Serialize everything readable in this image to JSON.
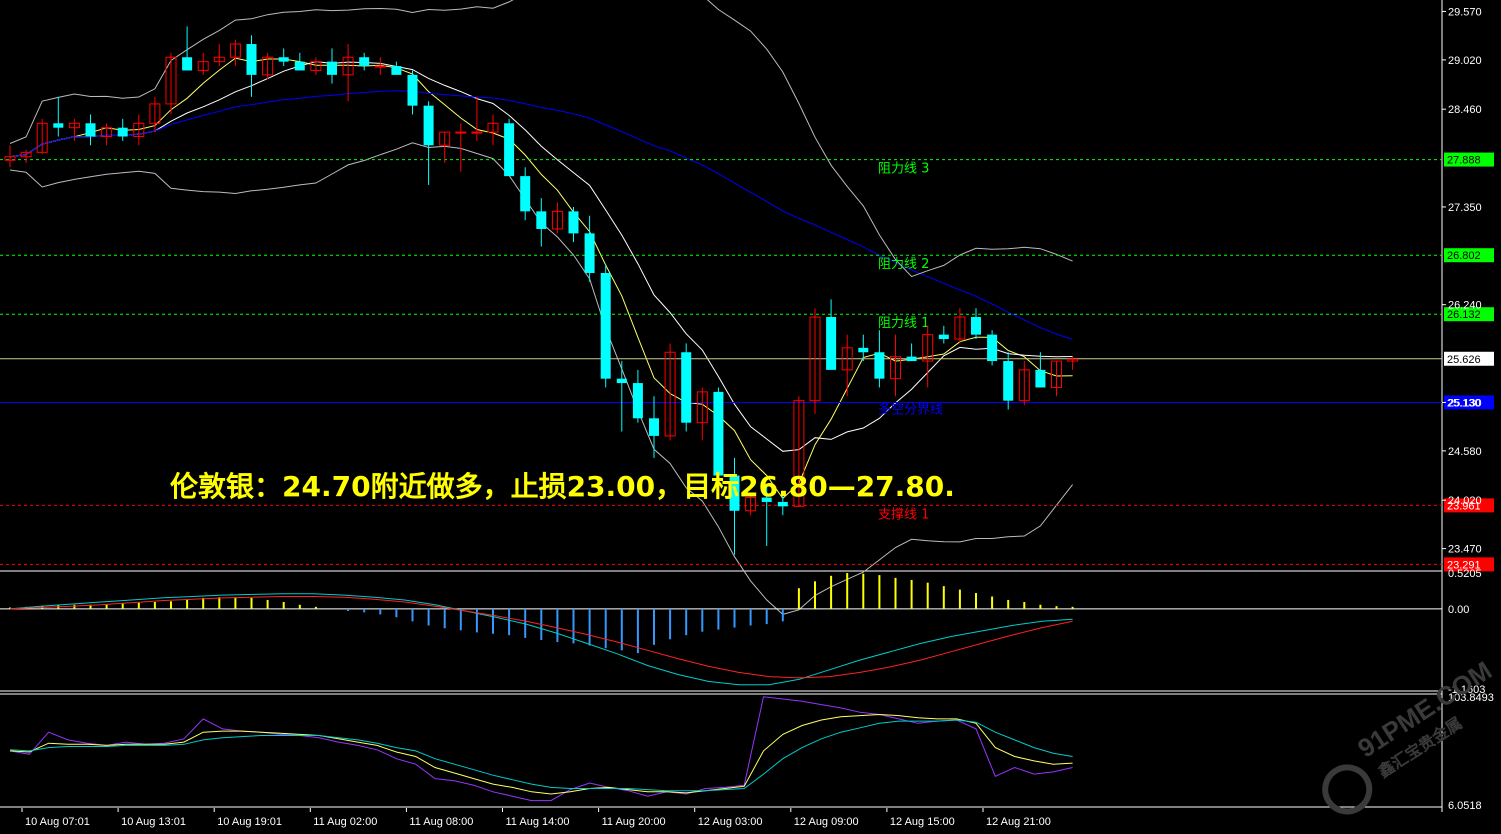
{
  "headline": "伦敦银：24.70附近做多，止损23.00，目标26.80—27.80.",
  "watermark": {
    "brand": "91PME.COM",
    "cn": "鑫汇宝贵金属"
  },
  "colors": {
    "bull": "#ff0000",
    "bear": "#00ffff",
    "ma_blue": "#0000ff",
    "resist": "#00ff00",
    "support": "#ff0000",
    "current": "#ffffff"
  },
  "chart_data": [
    {
      "type": "candlestick",
      "panel": "main",
      "ylim": [
        23.25,
        29.7
      ],
      "y_ticks": [
        "29.570",
        "29.020",
        "28.460",
        "27.350",
        "26.240",
        "25.130",
        "24.580",
        "24.020",
        "23.470"
      ],
      "x_ticks": [
        "10 Aug 07:01",
        "10 Aug 13:01",
        "10 Aug 19:01",
        "11 Aug 02:00",
        "11 Aug 08:00",
        "11 Aug 14:00",
        "11 Aug 20:00",
        "12 Aug 03:00",
        "12 Aug 09:00",
        "12 Aug 15:00",
        "12 Aug 21:00"
      ],
      "levels": [
        {
          "name": "阻力线 3",
          "value": 27.888,
          "label": "27.888",
          "kind": "resist"
        },
        {
          "name": "阻力线 2",
          "value": 26.802,
          "label": "26.802",
          "kind": "resist"
        },
        {
          "name": "阻力线 1",
          "value": 26.132,
          "label": "26.132",
          "kind": "resist"
        },
        {
          "name": "",
          "value": 25.626,
          "label": "25.626",
          "kind": "current"
        },
        {
          "name": "多空分界线",
          "value": 25.13,
          "label": "25.130",
          "kind": "pivot"
        },
        {
          "name": "支撑线 1",
          "value": 23.961,
          "label": "23.961",
          "kind": "support"
        },
        {
          "name": "",
          "value": 23.291,
          "label": "23.291",
          "kind": "support"
        }
      ],
      "ohlc": [
        [
          27.88,
          28.05,
          27.8,
          27.92
        ],
        [
          27.92,
          28.0,
          27.85,
          27.97
        ],
        [
          27.97,
          28.35,
          27.95,
          28.3
        ],
        [
          28.3,
          28.6,
          28.15,
          28.25
        ],
        [
          28.25,
          28.35,
          28.1,
          28.3
        ],
        [
          28.3,
          28.4,
          28.05,
          28.15
        ],
        [
          28.15,
          28.3,
          28.05,
          28.25
        ],
        [
          28.25,
          28.35,
          28.1,
          28.15
        ],
        [
          28.15,
          28.4,
          28.05,
          28.3
        ],
        [
          28.3,
          28.6,
          28.2,
          28.52
        ],
        [
          28.52,
          29.1,
          28.4,
          29.05
        ],
        [
          29.05,
          29.4,
          28.9,
          28.9
        ],
        [
          28.9,
          29.1,
          28.85,
          29.0
        ],
        [
          29.0,
          29.2,
          28.95,
          29.05
        ],
        [
          29.05,
          29.25,
          28.95,
          29.2
        ],
        [
          29.2,
          29.3,
          28.6,
          28.85
        ],
        [
          28.85,
          29.1,
          28.8,
          29.05
        ],
        [
          29.05,
          29.15,
          28.95,
          29.0
        ],
        [
          29.0,
          29.1,
          28.9,
          28.9
        ],
        [
          28.9,
          29.05,
          28.85,
          29.0
        ],
        [
          29.0,
          29.15,
          28.75,
          28.85
        ],
        [
          28.85,
          29.2,
          28.55,
          29.05
        ],
        [
          29.05,
          29.1,
          28.9,
          28.95
        ],
        [
          28.95,
          29.05,
          28.85,
          28.95
        ],
        [
          28.95,
          29.0,
          28.85,
          28.85
        ],
        [
          28.85,
          28.9,
          28.4,
          28.5
        ],
        [
          28.5,
          28.55,
          27.6,
          28.05
        ],
        [
          28.05,
          28.2,
          27.85,
          28.2
        ],
        [
          28.2,
          28.3,
          27.75,
          28.2
        ],
        [
          28.2,
          28.6,
          28.1,
          28.2
        ],
        [
          28.2,
          28.4,
          28.05,
          28.3
        ],
        [
          28.3,
          28.35,
          27.8,
          27.7
        ],
        [
          27.7,
          27.8,
          27.2,
          27.3
        ],
        [
          27.3,
          27.45,
          26.9,
          27.1
        ],
        [
          27.1,
          27.4,
          27.05,
          27.3
        ],
        [
          27.3,
          27.35,
          26.95,
          27.05
        ],
        [
          27.05,
          27.25,
          26.5,
          26.6
        ],
        [
          26.6,
          26.7,
          25.3,
          25.4
        ],
        [
          25.4,
          25.6,
          24.8,
          25.35
        ],
        [
          25.35,
          25.5,
          24.9,
          24.95
        ],
        [
          24.95,
          25.2,
          24.5,
          24.75
        ],
        [
          24.75,
          25.8,
          24.7,
          25.7
        ],
        [
          25.7,
          25.8,
          24.8,
          24.9
        ],
        [
          24.9,
          25.3,
          24.7,
          25.25
        ],
        [
          25.25,
          25.3,
          24.2,
          24.3
        ],
        [
          24.3,
          24.5,
          23.4,
          23.9
        ],
        [
          23.9,
          24.1,
          23.85,
          24.05
        ],
        [
          24.05,
          24.2,
          23.5,
          24.0
        ],
        [
          24.0,
          24.1,
          23.85,
          23.95
        ],
        [
          23.95,
          25.2,
          23.95,
          25.15
        ],
        [
          25.15,
          26.2,
          25.0,
          26.1
        ],
        [
          26.1,
          26.3,
          25.5,
          25.5
        ],
        [
          25.5,
          25.9,
          25.2,
          25.75
        ],
        [
          25.75,
          25.9,
          25.6,
          25.7
        ],
        [
          25.7,
          25.95,
          25.3,
          25.4
        ],
        [
          25.4,
          25.9,
          25.2,
          25.65
        ],
        [
          25.65,
          25.8,
          25.6,
          25.6
        ],
        [
          25.6,
          26.0,
          25.3,
          25.9
        ],
        [
          25.9,
          26.0,
          25.8,
          25.85
        ],
        [
          25.85,
          26.2,
          25.8,
          26.1
        ],
        [
          26.1,
          26.2,
          25.85,
          25.9
        ],
        [
          25.9,
          25.95,
          25.55,
          25.6
        ],
        [
          25.6,
          25.7,
          25.05,
          25.15
        ],
        [
          25.15,
          25.6,
          25.1,
          25.5
        ],
        [
          25.5,
          25.7,
          25.4,
          25.3
        ],
        [
          25.3,
          25.6,
          25.2,
          25.6
        ],
        [
          25.6,
          25.65,
          25.5,
          25.62
        ]
      ]
    },
    {
      "type": "bar",
      "panel": "macd",
      "ylim": [
        -1.1603,
        0.5205
      ],
      "y_ticks": [
        "0.5205",
        "0.00",
        "-1.1603"
      ],
      "histogram": [
        0.02,
        0.03,
        0.04,
        0.05,
        0.06,
        0.06,
        0.07,
        0.08,
        0.09,
        0.1,
        0.11,
        0.14,
        0.16,
        0.17,
        0.17,
        0.16,
        0.13,
        0.1,
        0.06,
        0.03,
        0.0,
        -0.03,
        -0.05,
        -0.08,
        -0.12,
        -0.18,
        -0.24,
        -0.28,
        -0.31,
        -0.34,
        -0.36,
        -0.38,
        -0.42,
        -0.45,
        -0.48,
        -0.5,
        -0.53,
        -0.57,
        -0.6,
        -0.64,
        -0.52,
        -0.44,
        -0.38,
        -0.33,
        -0.3,
        -0.27,
        -0.24,
        -0.22,
        -0.18,
        0.3,
        0.4,
        0.48,
        0.52,
        0.51,
        0.49,
        0.45,
        0.42,
        0.38,
        0.33,
        0.28,
        0.23,
        0.18,
        0.13,
        0.1,
        0.06,
        0.04,
        0.03
      ],
      "series": [
        {
          "values": [
            0.0,
            0.04,
            0.07,
            0.1,
            0.13,
            0.16,
            0.18,
            0.2,
            0.21,
            0.22,
            0.22,
            0.2,
            0.17,
            0.13,
            0.06,
            -0.03,
            -0.12,
            -0.22,
            -0.35,
            -0.5,
            -0.65,
            -0.82,
            -0.95,
            -1.05,
            -1.1,
            -1.1,
            -1.02,
            -0.88,
            -0.74,
            -0.62,
            -0.5,
            -0.4,
            -0.32,
            -0.24,
            -0.18,
            -0.15
          ]
        },
        {
          "values": [
            0.0,
            0.02,
            0.04,
            0.06,
            0.09,
            0.12,
            0.14,
            0.16,
            0.17,
            0.18,
            0.18,
            0.17,
            0.14,
            0.1,
            0.04,
            -0.03,
            -0.1,
            -0.18,
            -0.27,
            -0.37,
            -0.48,
            -0.6,
            -0.72,
            -0.83,
            -0.92,
            -0.98,
            -1.0,
            -0.98,
            -0.92,
            -0.84,
            -0.74,
            -0.62,
            -0.5,
            -0.38,
            -0.27,
            -0.18
          ]
        }
      ]
    },
    {
      "type": "line",
      "panel": "kdj",
      "ylim": [
        6.0518,
        103.8493
      ],
      "y_ticks": [
        "103.8493",
        "6.0518"
      ],
      "series": [
        {
          "values": [
            55,
            52,
            72,
            65,
            62,
            60,
            63,
            61,
            62,
            66,
            84,
            75,
            73,
            72,
            70,
            69,
            67,
            63,
            60,
            56,
            48,
            43,
            30,
            28,
            24,
            18,
            14,
            10,
            10,
            20,
            26,
            22,
            19,
            14,
            18,
            16,
            21,
            22,
            24,
            104,
            102,
            100,
            97,
            94,
            90,
            88,
            84,
            80,
            82,
            83,
            75,
            32,
            40,
            34,
            36,
            40
          ]
        },
        {
          "values": [
            55,
            54,
            62,
            61,
            61,
            60,
            61,
            61,
            61,
            63,
            72,
            73,
            73,
            72,
            71,
            70,
            69,
            66,
            63,
            60,
            54,
            50,
            40,
            35,
            30,
            25,
            22,
            18,
            16,
            18,
            21,
            22,
            20,
            18,
            18,
            17,
            19,
            21,
            23,
            55,
            70,
            78,
            83,
            86,
            87,
            88,
            87,
            85,
            84,
            84,
            80,
            58,
            50,
            46,
            43,
            44
          ]
        },
        {
          "values": [
            56,
            55,
            58,
            59,
            59,
            59,
            60,
            60,
            60,
            61,
            65,
            67,
            68,
            69,
            69,
            69,
            69,
            67,
            65,
            62,
            58,
            55,
            48,
            43,
            38,
            33,
            29,
            25,
            22,
            21,
            21,
            21,
            21,
            20,
            19,
            19,
            19,
            20,
            21,
            34,
            48,
            58,
            66,
            72,
            76,
            80,
            82,
            82,
            82,
            83,
            81,
            72,
            65,
            58,
            53,
            50
          ]
        }
      ]
    }
  ]
}
